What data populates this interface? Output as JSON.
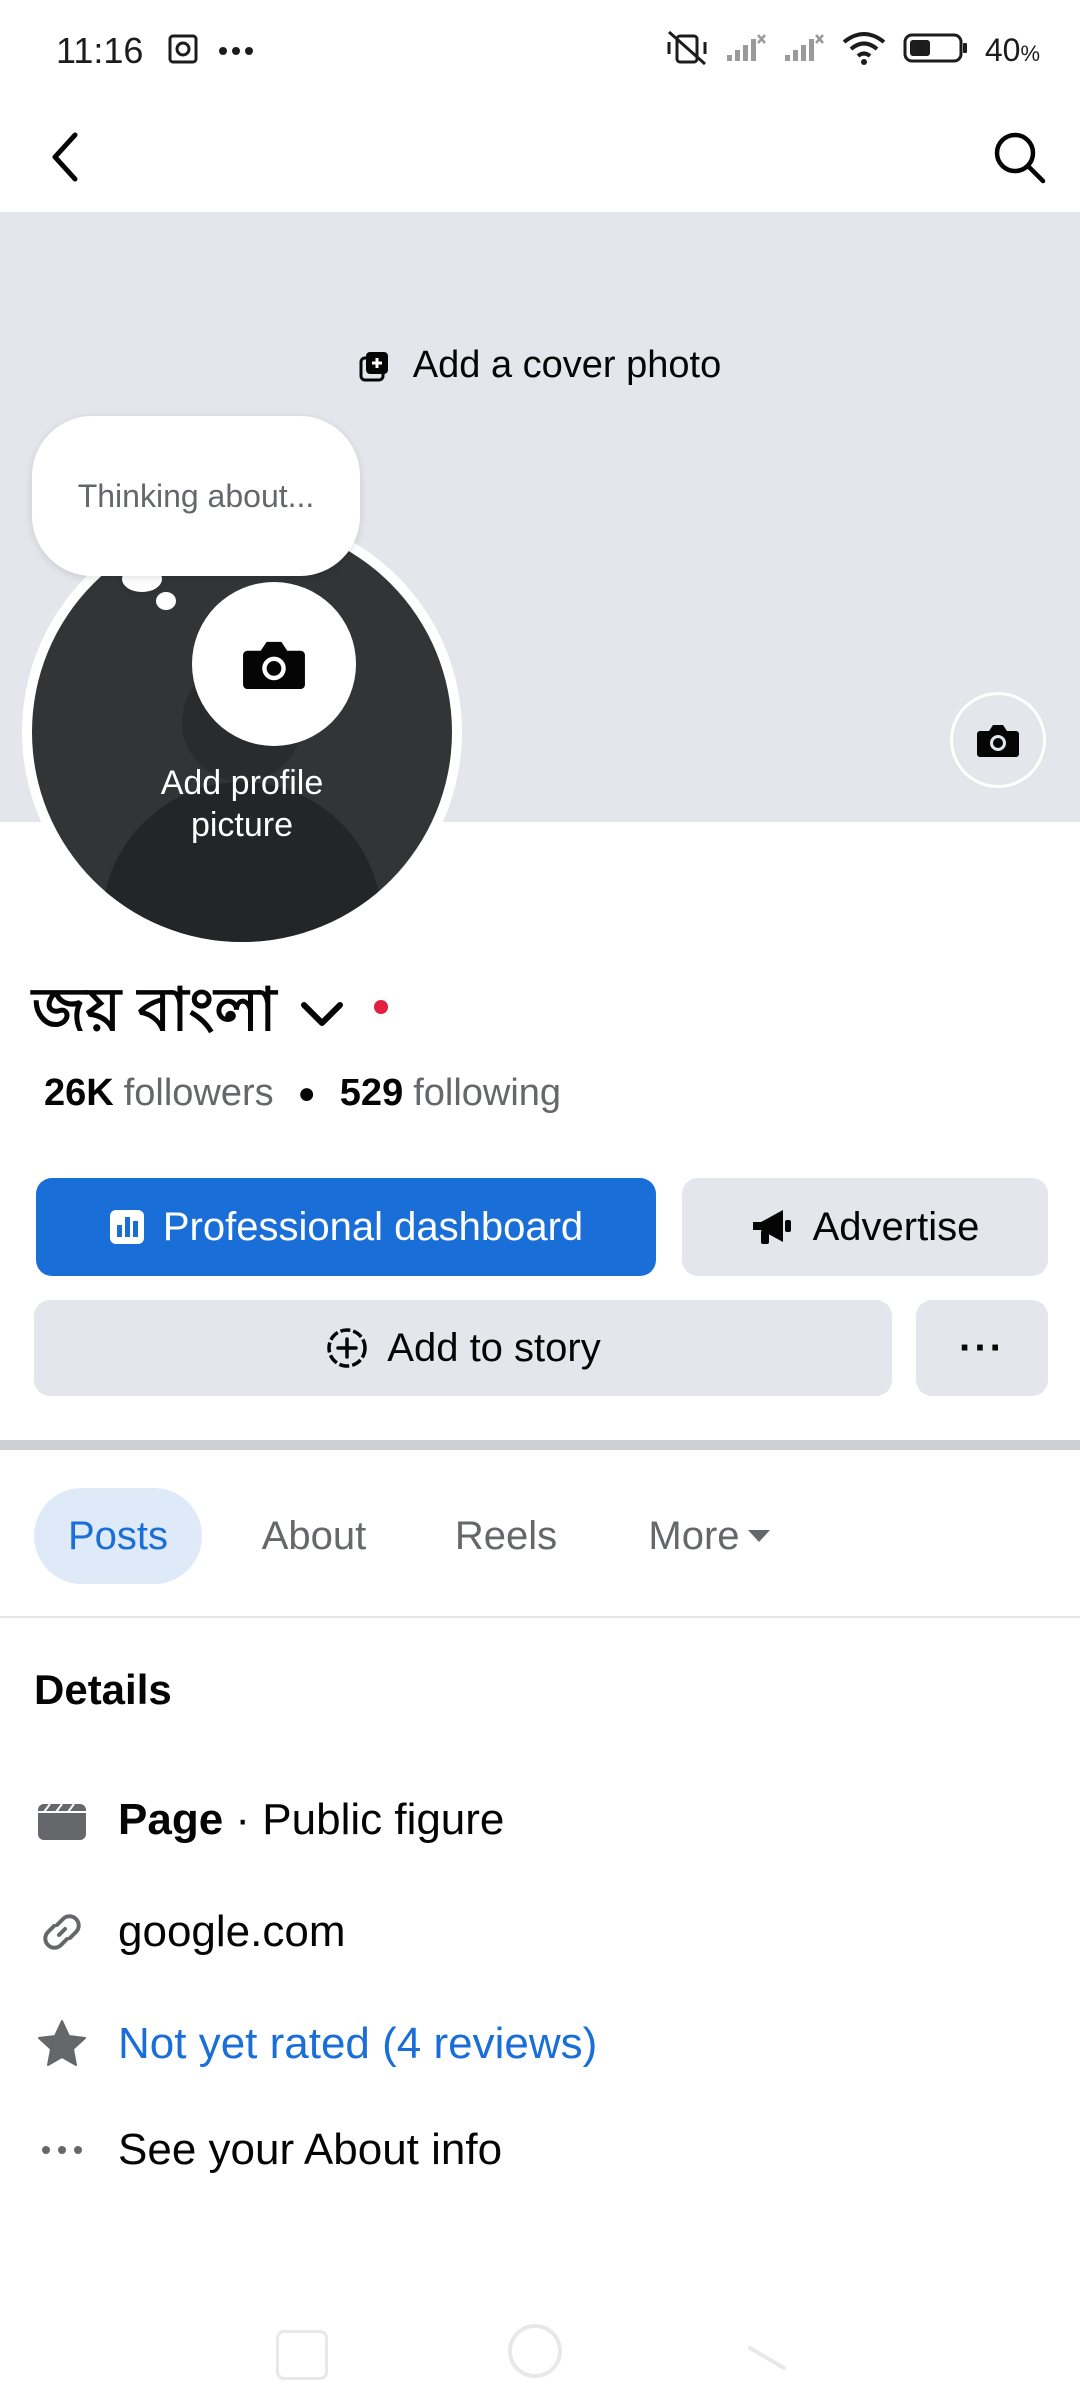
{
  "status_bar": {
    "time": "11:16",
    "battery": "40",
    "battery_unit": "%"
  },
  "topnav": {
    "back_icon": "chevron-left-icon",
    "search_icon": "search-icon"
  },
  "cover": {
    "add_cover_label": "Add a cover photo"
  },
  "profile": {
    "thought_placeholder": "Thinking about...",
    "add_picture_label": "Add profile picture",
    "name": "জয় বাংলা",
    "followers_count": "26K",
    "followers_label": "followers",
    "following_count": "529",
    "following_label": "following"
  },
  "actions": {
    "professional_dashboard": "Professional dashboard",
    "advertise": "Advertise",
    "add_to_story": "Add to story",
    "more": "···"
  },
  "tabs": [
    {
      "label": "Posts",
      "active": true
    },
    {
      "label": "About",
      "active": false
    },
    {
      "label": "Reels",
      "active": false
    },
    {
      "label": "More",
      "active": false
    }
  ],
  "details": {
    "title": "Details",
    "page_label": "Page",
    "page_category": " · Public figure",
    "website": "google.com",
    "rating": "Not yet rated (4 reviews)",
    "about": "See your About info"
  },
  "colors": {
    "primary": "#1a6ed8",
    "secondary_button": "#e4e6eb",
    "cover": "#e4e6eb",
    "notification_dot": "#e41e3f"
  }
}
